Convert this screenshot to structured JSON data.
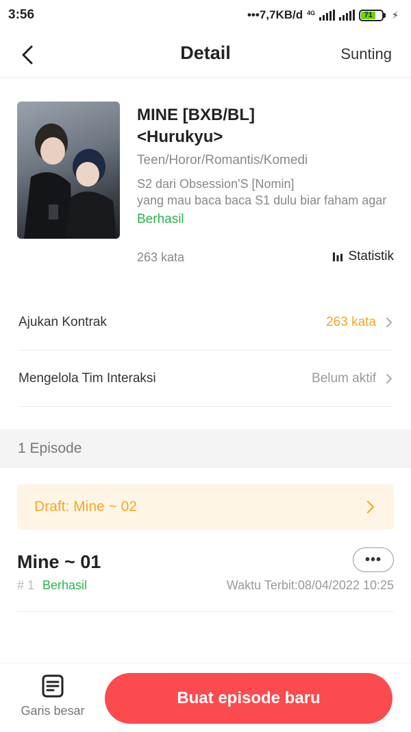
{
  "status_bar": {
    "time": "3:56",
    "network_speed": "•••7,7KB/d",
    "network_type": "4G",
    "battery_level": "71",
    "battery_percent": 71,
    "colors": {
      "battery_fill": "#6dd400"
    }
  },
  "header": {
    "title": "Detail",
    "edit_label": "Sunting"
  },
  "book": {
    "title_line1": "MINE [BXB/BL]",
    "title_line2": "<Hurukyu>",
    "genre": "Teen/Horor/Romantis/Komedi",
    "description_line1": "S2 dari Obsession'S [Nomin]",
    "description_line2": "yang mau baca baca S1 dulu biar faham agar",
    "status": "Berhasil",
    "word_count": "263 kata",
    "stats_label": "Statistik"
  },
  "rows": {
    "contract_label": "Ajukan Kontrak",
    "contract_value": "263 kata",
    "interaction_label": "Mengelola Tim Interaksi",
    "interaction_value": "Belum aktif"
  },
  "episodes": {
    "section_title": "1 Episode",
    "draft_label": "Draft: Mine ~ 02",
    "items": [
      {
        "title": "Mine ~ 01",
        "number": "# 1",
        "status": "Berhasil",
        "publish_time": "Waktu Terbit:08/04/2022 10:25",
        "more_label": "•••"
      }
    ]
  },
  "bottom_bar": {
    "outline_label": "Garis besar",
    "create_label": "Buat episode baru"
  },
  "colors": {
    "accent_red": "#fb4b4e",
    "success_green": "#2bb34b",
    "warning_orange": "#f5a623",
    "draft_background": "#fff5e6"
  },
  "icons": {
    "back": "chevron-left-icon",
    "stats": "bar-chart-icon",
    "row_arrow": "chevron-right-icon",
    "outline": "document-list-icon"
  }
}
